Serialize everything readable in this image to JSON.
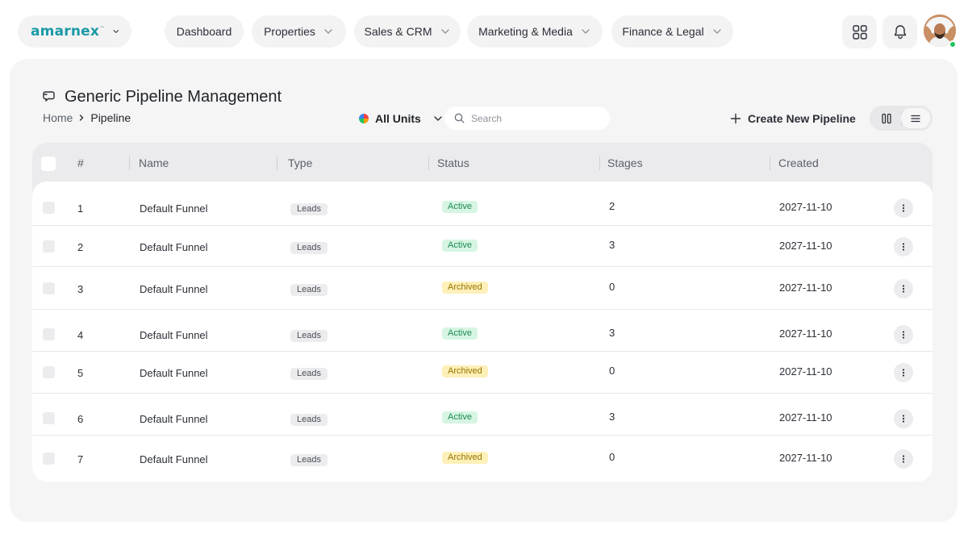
{
  "brand": {
    "logo": "amarnex",
    "mark": "™"
  },
  "nav": {
    "items": [
      {
        "label": "Dashboard"
      },
      {
        "label": "Properties"
      },
      {
        "label": "Sales & CRM"
      },
      {
        "label": "Marketing & Media"
      },
      {
        "label": "Finance & Legal"
      }
    ],
    "apps_icon": "grid-icon",
    "notifications_icon": "bell-icon",
    "avatar_status_color": "#22c55e"
  },
  "page": {
    "title": "Generic Pipeline Management",
    "breadcrumb": {
      "home": "Home",
      "current": "Pipeline"
    }
  },
  "toolbar": {
    "units_label": "All Units",
    "search_placeholder": "Search",
    "create_label": "Create New Pipeline",
    "view_modes": [
      "columns",
      "list"
    ],
    "active_view": "list"
  },
  "table": {
    "columns": [
      "#",
      "Name",
      "Type",
      "Status",
      "Stages",
      "Created"
    ],
    "rows": [
      {
        "num": "1",
        "name": "Default Funnel",
        "type": "Leads",
        "status": "Active",
        "stages": "2",
        "created": "2027-11-10"
      },
      {
        "num": "2",
        "name": "Default Funnel",
        "type": "Leads",
        "status": "Active",
        "stages": "3",
        "created": "2027-11-10"
      },
      {
        "num": "3",
        "name": "Default Funnel",
        "type": "Leads",
        "status": "Archived",
        "stages": "0",
        "created": "2027-11-10"
      },
      {
        "num": "4",
        "name": "Default Funnel",
        "type": "Leads",
        "status": "Active",
        "stages": "3",
        "created": "2027-11-10"
      },
      {
        "num": "5",
        "name": "Default Funnel",
        "type": "Leads",
        "status": "Archived",
        "stages": "0",
        "created": "2027-11-10"
      },
      {
        "num": "6",
        "name": "Default Funnel",
        "type": "Leads",
        "status": "Active",
        "stages": "3",
        "created": "2027-11-10"
      },
      {
        "num": "7",
        "name": "Default Funnel",
        "type": "Leads",
        "status": "Archived",
        "stages": "0",
        "created": "2027-11-10"
      }
    ]
  },
  "colors": {
    "brand": "#1a9aa6",
    "active_bg": "#d6f5e3",
    "active_text": "#1d8a54",
    "archived_bg": "#fdf0b8",
    "archived_text": "#9a7300"
  }
}
